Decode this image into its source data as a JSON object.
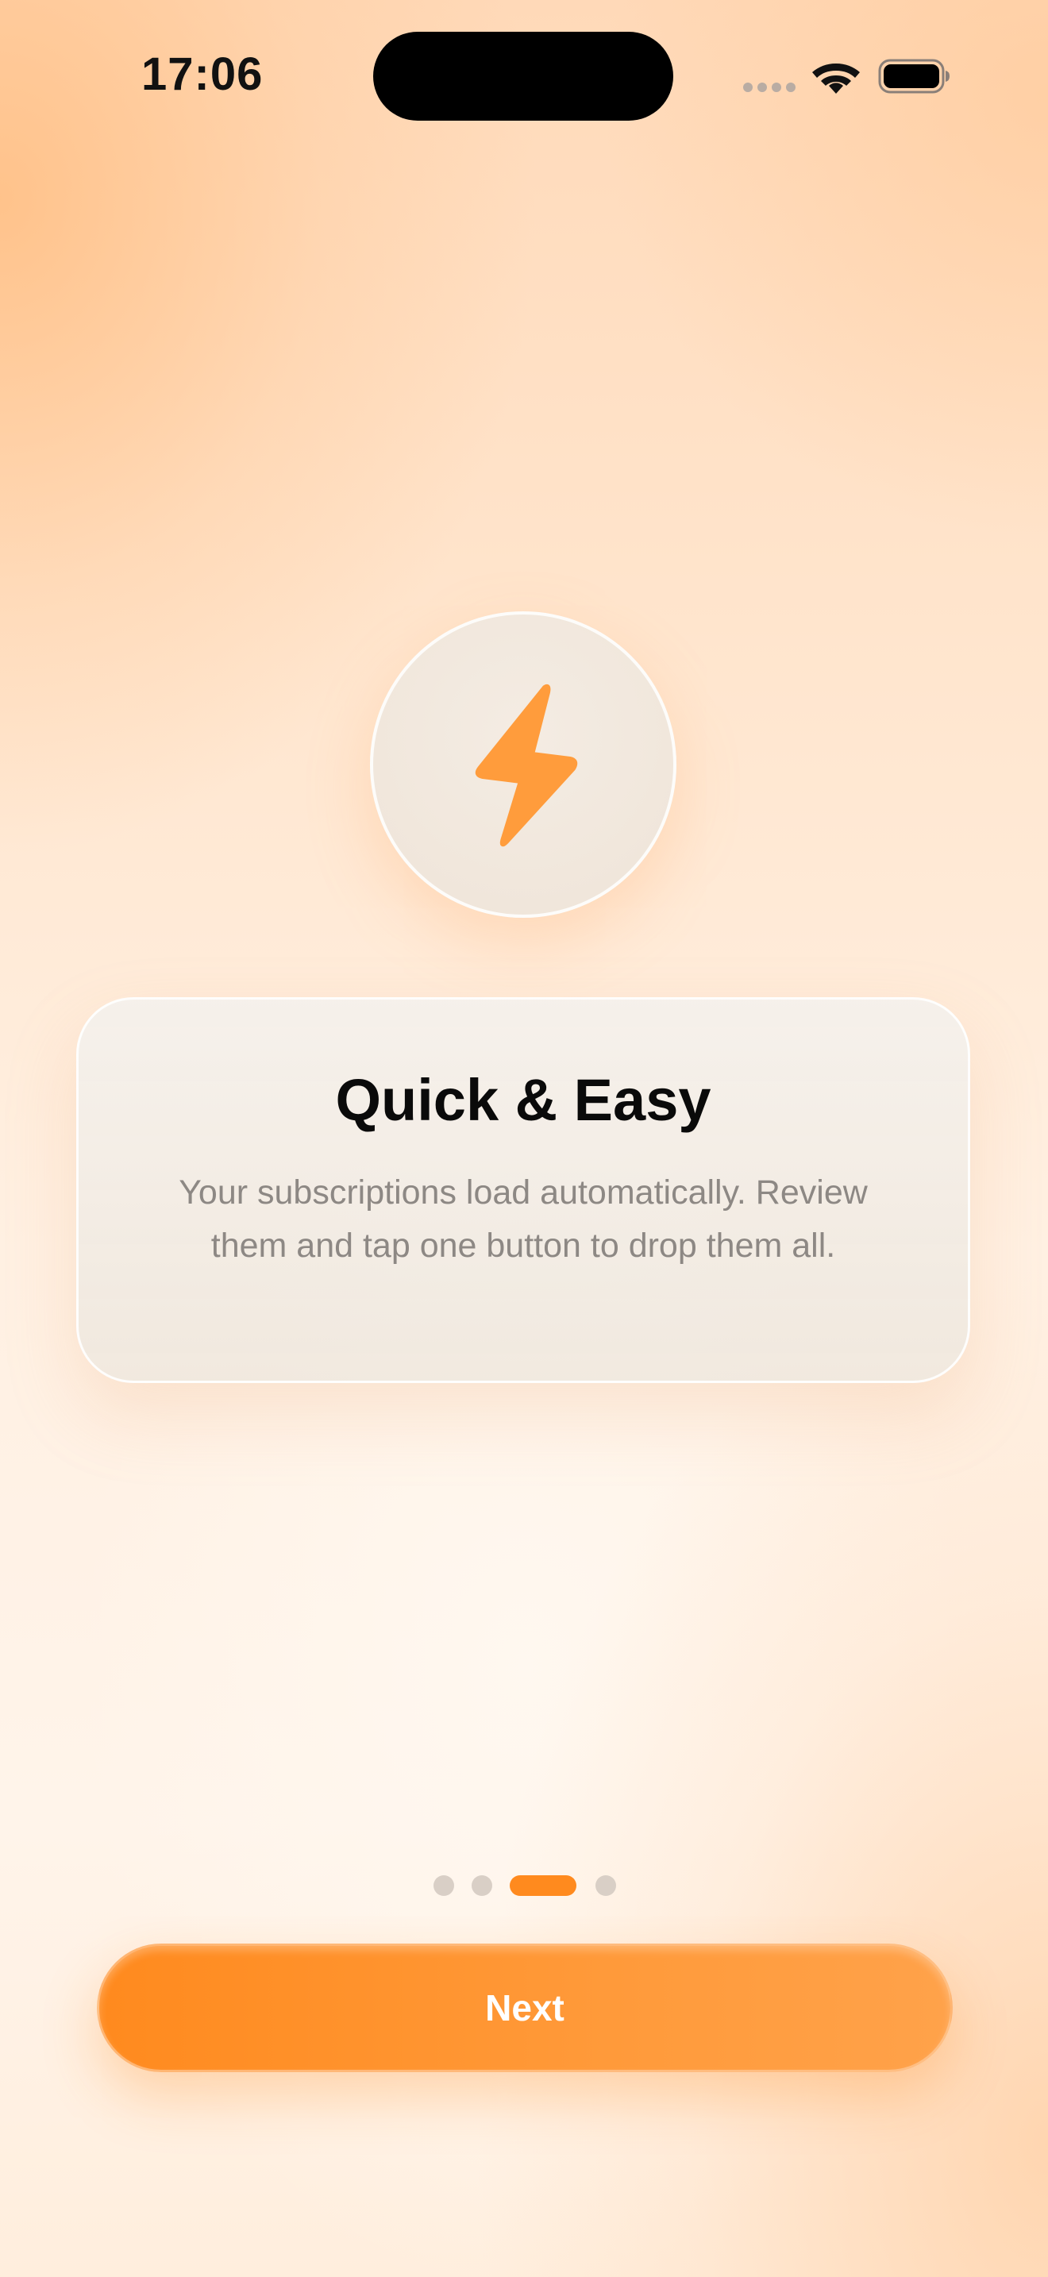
{
  "status_bar": {
    "time": "17:06",
    "icons": [
      "signal-icon",
      "wifi-icon",
      "battery-icon"
    ]
  },
  "onboarding": {
    "icon": "lightning-bolt-icon",
    "title": "Quick & Easy",
    "description": "Your subscriptions load automatically. Review them and tap one button to drop them all.",
    "page_indicator": {
      "total": 4,
      "current": 3
    },
    "next_label": "Next"
  },
  "colors": {
    "accent": "#ff8a1e",
    "bolt": "#ff9c3c",
    "inactive_dot": "#d9cfc6",
    "title": "#0a0a0a",
    "body_text": "#8d8884"
  }
}
